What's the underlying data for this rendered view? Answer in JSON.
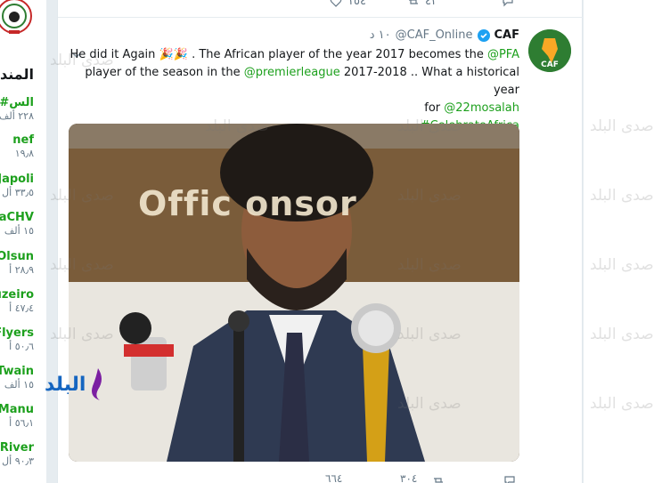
{
  "trends": {
    "title": "المند",
    "items": [
      {
        "name": "#الس",
        "count": "٢٢٨ ألف"
      },
      {
        "name": "nef",
        "count": "١٩٫٨"
      },
      {
        "name": "Japoli",
        "count": "٣٣٫٥ أل"
      },
      {
        "name": "aCHV",
        "count": "١٥ ألف"
      },
      {
        "name": "Olsun",
        "count": "٢٨٫٩ أ"
      },
      {
        "name": "uzeiro",
        "count": "٤٧٫٤ أ"
      },
      {
        "name": "Flyers",
        "count": "٥٠٫٦ أ"
      },
      {
        "name": "Twain",
        "count": "١٥ ألف"
      },
      {
        "name": "Manu",
        "count": "٥٦٫١ أ"
      },
      {
        "name": "River",
        "count": "٩٠٫٣ أل"
      }
    ]
  },
  "previous_tweet": {
    "retweets": "٤٢",
    "likes": "١٥٤"
  },
  "tweet": {
    "display_name": "CAF",
    "handle": "@CAF_Online",
    "time": "١٠ د",
    "body": {
      "line1_pre": "He did it Again",
      "line1_emoji": "🎉🎉",
      "line1_mid": ". The African player of the year 2017 becomes the ",
      "mention_pfa": "@PFA",
      "line2_pre": "player of the season in the ",
      "mention_pl": "@premierleague",
      "line2_post": " 2017-2018 .. What a historical year",
      "line3_pre": "for ",
      "mention_salah": "@22mosalah",
      "hashtag": "#CelebrateAfrica"
    },
    "media_text": {
      "sign": "Offic   onsor"
    },
    "actions": {
      "likes": "٦٦٤",
      "retweets": "٣٠٤"
    }
  },
  "watermark": "صدى البلد",
  "brand_text": "البلد",
  "colors": {
    "link": "#1da01d",
    "verified": "#1da1f2",
    "muted": "#657786"
  }
}
